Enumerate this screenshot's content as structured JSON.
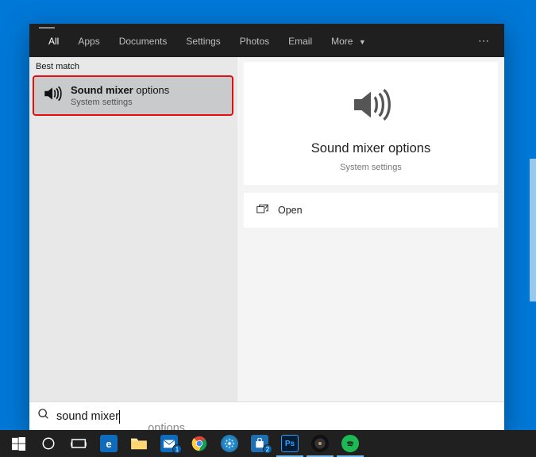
{
  "tabs": {
    "all": "All",
    "apps": "Apps",
    "documents": "Documents",
    "settings": "Settings",
    "photos": "Photos",
    "email": "Email",
    "more": "More"
  },
  "left": {
    "section": "Best match",
    "result": {
      "title_bold": "Sound mixer",
      "title_rest": " options",
      "subtitle": "System settings"
    }
  },
  "preview": {
    "title": "Sound mixer options",
    "subtitle": "System settings",
    "open": "Open"
  },
  "search": {
    "typed": "sound mixer",
    "ghost_suffix": " options"
  },
  "taskbar": {
    "badges": {
      "mail": "1",
      "store": "2"
    }
  }
}
